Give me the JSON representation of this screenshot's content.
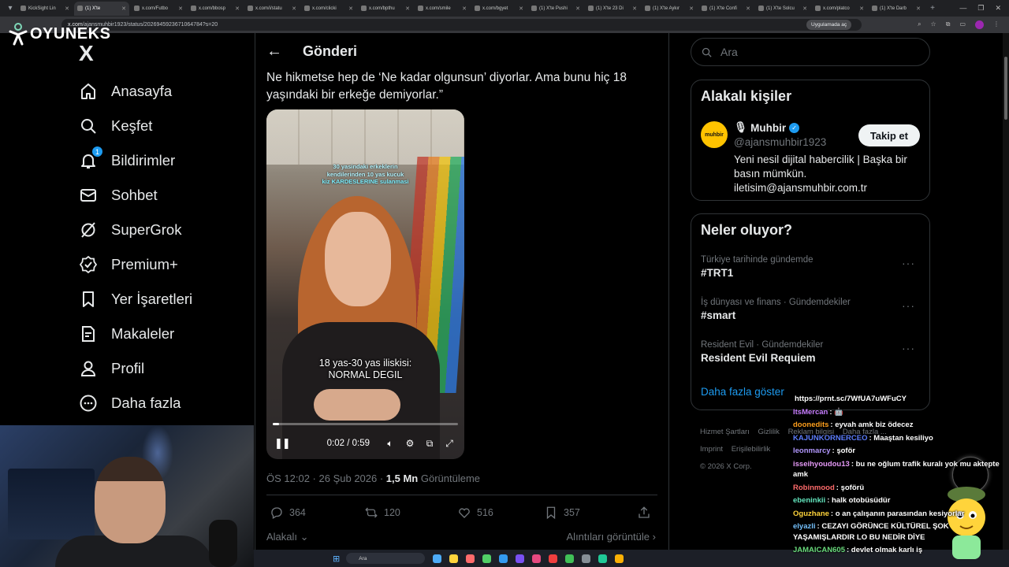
{
  "browser": {
    "tabs": [
      {
        "label": "KickSight Lin",
        "active": false
      },
      {
        "label": "(1) X'te",
        "active": true
      },
      {
        "label": "x.com/Futbo",
        "active": false
      },
      {
        "label": "x.com/bbosp",
        "active": false
      },
      {
        "label": "x.com/i/statu",
        "active": false
      },
      {
        "label": "x.com/clicki",
        "active": false
      },
      {
        "label": "x.com/bpthu",
        "active": false
      },
      {
        "label": "x.com/smile",
        "active": false
      },
      {
        "label": "x.com/bgyet",
        "active": false
      },
      {
        "label": "(1) X'te Pushi",
        "active": false
      },
      {
        "label": "(1) X'te 23 Di",
        "active": false
      },
      {
        "label": "(1) X'te Aykır",
        "active": false
      },
      {
        "label": "(1) X'te Confi",
        "active": false
      },
      {
        "label": "(1) X'te Solcu",
        "active": false
      },
      {
        "label": "x.com/platco",
        "active": false
      },
      {
        "label": "(1) X'te Darb",
        "active": false
      }
    ],
    "url_domain": "x.com",
    "url_path": "/ajansmuhbir1923/status/2026945923671064784?s=20",
    "open_in_app": "Uygulamada aç"
  },
  "overlay_logo": "OYUNEKS",
  "nav": {
    "logo": "X",
    "items": [
      {
        "label": "Anasayfa",
        "icon": "home-icon"
      },
      {
        "label": "Keşfet",
        "icon": "search-icon"
      },
      {
        "label": "Bildirimler",
        "icon": "bell-icon",
        "badge": "1"
      },
      {
        "label": "Sohbet",
        "icon": "mail-icon"
      },
      {
        "label": "SuperGrok",
        "icon": "grok-icon"
      },
      {
        "label": "Premium+",
        "icon": "verified-icon"
      },
      {
        "label": "Yer İşaretleri",
        "icon": "bookmark-icon"
      },
      {
        "label": "Makaleler",
        "icon": "article-icon"
      },
      {
        "label": "Profil",
        "icon": "profile-icon"
      },
      {
        "label": "Daha fazla",
        "icon": "more-icon"
      }
    ]
  },
  "post": {
    "header_title": "Gönderi",
    "text": "Ne hikmetse hep de ‘Ne kadar olgunsun’ diyorlar. Ama bunu hiç 18 yaşındaki bir erkeğe demiyorlar.”",
    "video": {
      "top_caption_line1": "30 yasindaki erkeklerin",
      "top_caption_line2": "kendilerinden 10 yas kucuk",
      "top_caption_line3": "kiz KARDESLERINE sulanmasi",
      "subtitle_line1": "18 yas-30 yas iliskisi:",
      "subtitle_line2": "NORMAL DEGIL",
      "time": "0:02 / 0:59",
      "progress": 0.034
    },
    "time": "ÖS 12:02",
    "date": "26 Şub 2026",
    "views_count": "1,5 Mn",
    "views_label": "Görüntüleme",
    "replies": "364",
    "reposts": "120",
    "likes": "516",
    "bookmarks": "357",
    "relevant_label": "Alakalı",
    "quotes_label": "Alıntıları görüntüle"
  },
  "right": {
    "search_placeholder": "Ara",
    "people_title": "Alakalı kişiler",
    "person": {
      "avatar_text": "muhbir",
      "name": "Muhbir",
      "handle": "@ajansmuhbir1923",
      "bio": "Yeni nesil dijital habercilik | Başka bir basın mümkün. iletisim@ajansmuhbir.com.tr",
      "follow_label": "Takip et"
    },
    "trends_title": "Neler oluyor?",
    "trends": [
      {
        "context": "Türkiye tarihinde gündemde",
        "name": "#TRT1"
      },
      {
        "context": "İş dünyası ve finans · Gündemdekiler",
        "name": "#smart"
      },
      {
        "context": "Resident Evil · Gündemdekiler",
        "name": "Resident Evil Requiem"
      }
    ],
    "show_more": "Daha fazla göster",
    "footer": [
      "Hizmet Şartları",
      "Gizlilik",
      "Reklam bilgisi",
      "Daha fazla ...",
      "Imprint",
      "Erişilebilirlik",
      "© 2026 X Corp."
    ]
  },
  "chat": [
    {
      "user": "",
      "color": "#ffffff",
      "msg": "https://prnt.sc/7WfUA7uWFuCY"
    },
    {
      "user": "ItsMercan",
      "color": "#c77dff",
      "msg": ": 🤖"
    },
    {
      "user": "doonedits",
      "color": "#ff9f1c",
      "msg": ": eyvah amk biz ödecez"
    },
    {
      "user": "KAJUNKORNERCEO",
      "color": "#5c7cfa",
      "msg": ": Maaştan kesiliyo"
    },
    {
      "user": "leonmarcy",
      "color": "#b197fc",
      "msg": ": şoför"
    },
    {
      "user": "isseihyoudou13",
      "color": "#e599f7",
      "msg": ": bu ne oğlum trafik kuralı yok mu aktepte amk"
    },
    {
      "user": "Robinmood",
      "color": "#ff6b6b",
      "msg": ": şoförü"
    },
    {
      "user": "ebeninkii",
      "color": "#63e6be",
      "msg": ": halk otobüsüdür"
    },
    {
      "user": "Oguzhane",
      "color": "#ffd43b",
      "msg": ": o an çalışanın parasından kesiyorlar"
    },
    {
      "user": "elyazli",
      "color": "#74c0fc",
      "msg": ": CEZAYI GÖRÜNCE KÜLTÜREL ŞOK YAŞAMIŞLARDIR LO BU NEDİR DİYE"
    },
    {
      "user": "JAMAICAN605",
      "color": "#69db7c",
      "msg": ": devlet olmak karlı iş"
    }
  ],
  "taskbar": {
    "search_label": "Ara"
  },
  "colors": {
    "accent": "#1d9bf0",
    "background": "#000000",
    "muted": "#71767b",
    "border": "#2f3336"
  }
}
